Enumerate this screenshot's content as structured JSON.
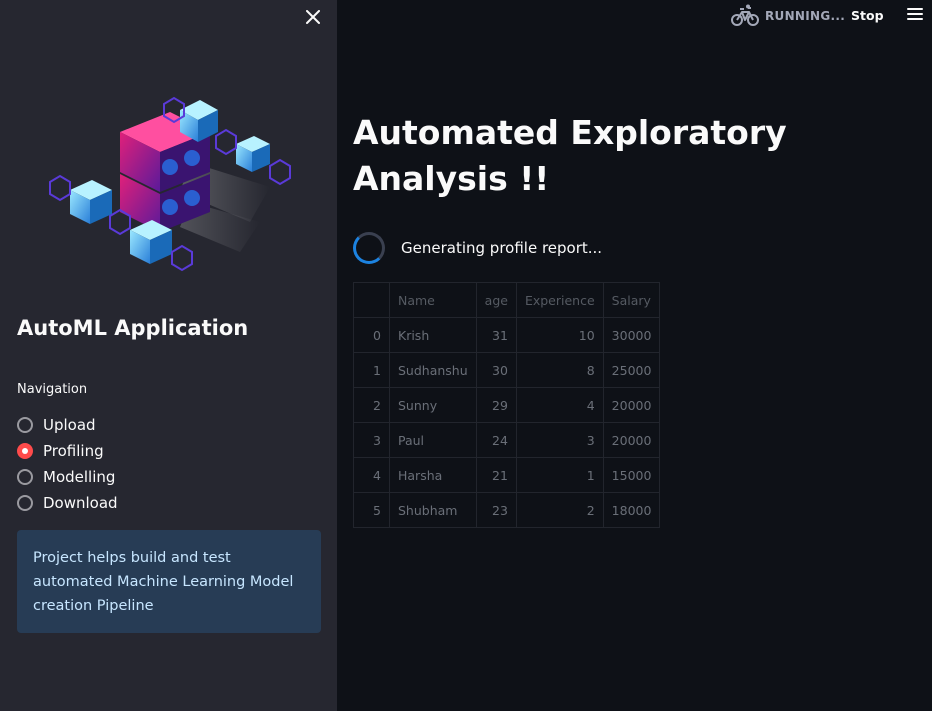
{
  "sidebar": {
    "app_title": "AutoML Application",
    "navigation_label": "Navigation",
    "nav_options": [
      {
        "label": "Upload",
        "selected": false
      },
      {
        "label": "Profiling",
        "selected": true
      },
      {
        "label": "Modelling",
        "selected": false
      },
      {
        "label": "Download",
        "selected": false
      }
    ],
    "info_text": "Project helps build and test automated Machine Learning Model creation Pipeline",
    "close_icon": "close-icon",
    "logo_icon": "automl-servers-cubes-illustration"
  },
  "topbar": {
    "status_text": "RUNNING...",
    "status_icon": "bicycle-icon",
    "stop_label": "Stop",
    "menu_icon": "hamburger-menu-icon"
  },
  "main": {
    "title": "Automated Exploratory Analysis !!",
    "spinner_text": "Generating profile report...",
    "table": {
      "columns": [
        "",
        "Name",
        "age",
        "Experience",
        "Salary"
      ],
      "rows": [
        [
          "0",
          "Krish",
          "31",
          "10",
          "30000"
        ],
        [
          "1",
          "Sudhanshu",
          "30",
          "8",
          "25000"
        ],
        [
          "2",
          "Sunny",
          "29",
          "4",
          "20000"
        ],
        [
          "3",
          "Paul",
          "24",
          "3",
          "20000"
        ],
        [
          "4",
          "Harsha",
          "21",
          "1",
          "15000"
        ],
        [
          "5",
          "Shubham",
          "23",
          "2",
          "18000"
        ]
      ]
    }
  },
  "colors": {
    "background": "#0e1117",
    "sidebar": "#262730",
    "accent": "#ff4b4b",
    "info_box": "#273c55",
    "spinner": "#1c83e1"
  }
}
